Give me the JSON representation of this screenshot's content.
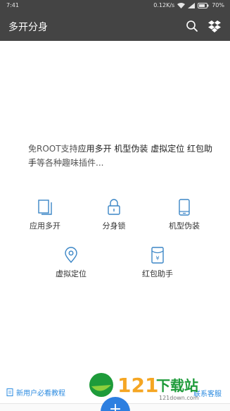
{
  "status_bar": {
    "time": "7:41",
    "network_speed": "0.12K/s",
    "battery": "70%"
  },
  "app_bar": {
    "title": "多开分身"
  },
  "description": {
    "prefix": "免ROOT支持",
    "highlight": "应用多开 机型伪装 虚拟定位 红包助手",
    "suffix": "等各种趣味插件..."
  },
  "features": [
    {
      "label": "应用多开",
      "icon": "copy-pages-icon"
    },
    {
      "label": "分身锁",
      "icon": "lock-icon"
    },
    {
      "label": "机型伪装",
      "icon": "phone-icon"
    },
    {
      "label": "虚拟定位",
      "icon": "location-pin-icon"
    },
    {
      "label": "红包助手",
      "icon": "red-envelope-icon"
    }
  ],
  "bottom": {
    "tutorial_label": "新用户必看教程",
    "contact_label": "联系客服"
  },
  "watermark": {
    "number": "121",
    "text": "下载站",
    "site": "121down.com"
  },
  "colors": {
    "appbar": "#444444",
    "accent_blue": "#2c8be0",
    "icon_blue": "#3b86c6"
  }
}
